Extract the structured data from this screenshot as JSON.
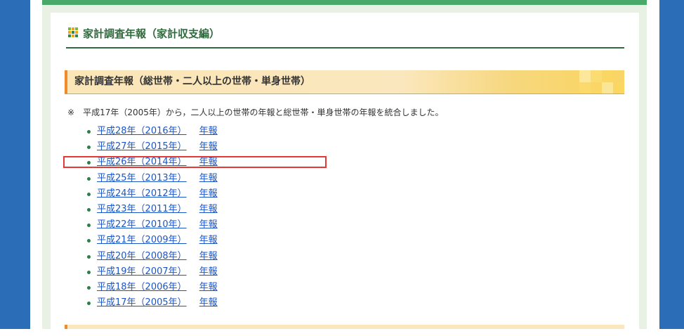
{
  "heading": {
    "title": "家計調査年報（家計収支編）"
  },
  "section": {
    "title": "家計調査年報（総世帯・二人以上の世帯・単身世帯）"
  },
  "note": {
    "mark": "※",
    "text": "平成17年（2005年）から，二人以上の世帯の年報と総世帯・単身世帯の年報を統合しました。"
  },
  "links": [
    {
      "year": "平成28年（2016年）",
      "suffix": "年報"
    },
    {
      "year": "平成27年（2015年）",
      "suffix": "年報"
    },
    {
      "year": "平成26年（2014年）",
      "suffix": "年報"
    },
    {
      "year": "平成25年（2013年）",
      "suffix": "年報"
    },
    {
      "year": "平成24年（2012年）",
      "suffix": "年報"
    },
    {
      "year": "平成23年（2011年）",
      "suffix": "年報"
    },
    {
      "year": "平成22年（2010年）",
      "suffix": "年報"
    },
    {
      "year": "平成21年（2009年）",
      "suffix": "年報"
    },
    {
      "year": "平成20年（2008年）",
      "suffix": "年報"
    },
    {
      "year": "平成19年（2007年）",
      "suffix": "年報"
    },
    {
      "year": "平成18年（2006年）",
      "suffix": "年報"
    },
    {
      "year": "平成17年（2005年）",
      "suffix": "年報"
    }
  ],
  "colors": {
    "side": "#2b6db6",
    "accent_green": "#2f6b3d",
    "link": "#1a55c8",
    "highlight": "#e53935",
    "band_border": "#f08a2a"
  },
  "icons": {
    "heading_icon": "grid-icon",
    "list_bullet": "bullet-dot-icon"
  }
}
